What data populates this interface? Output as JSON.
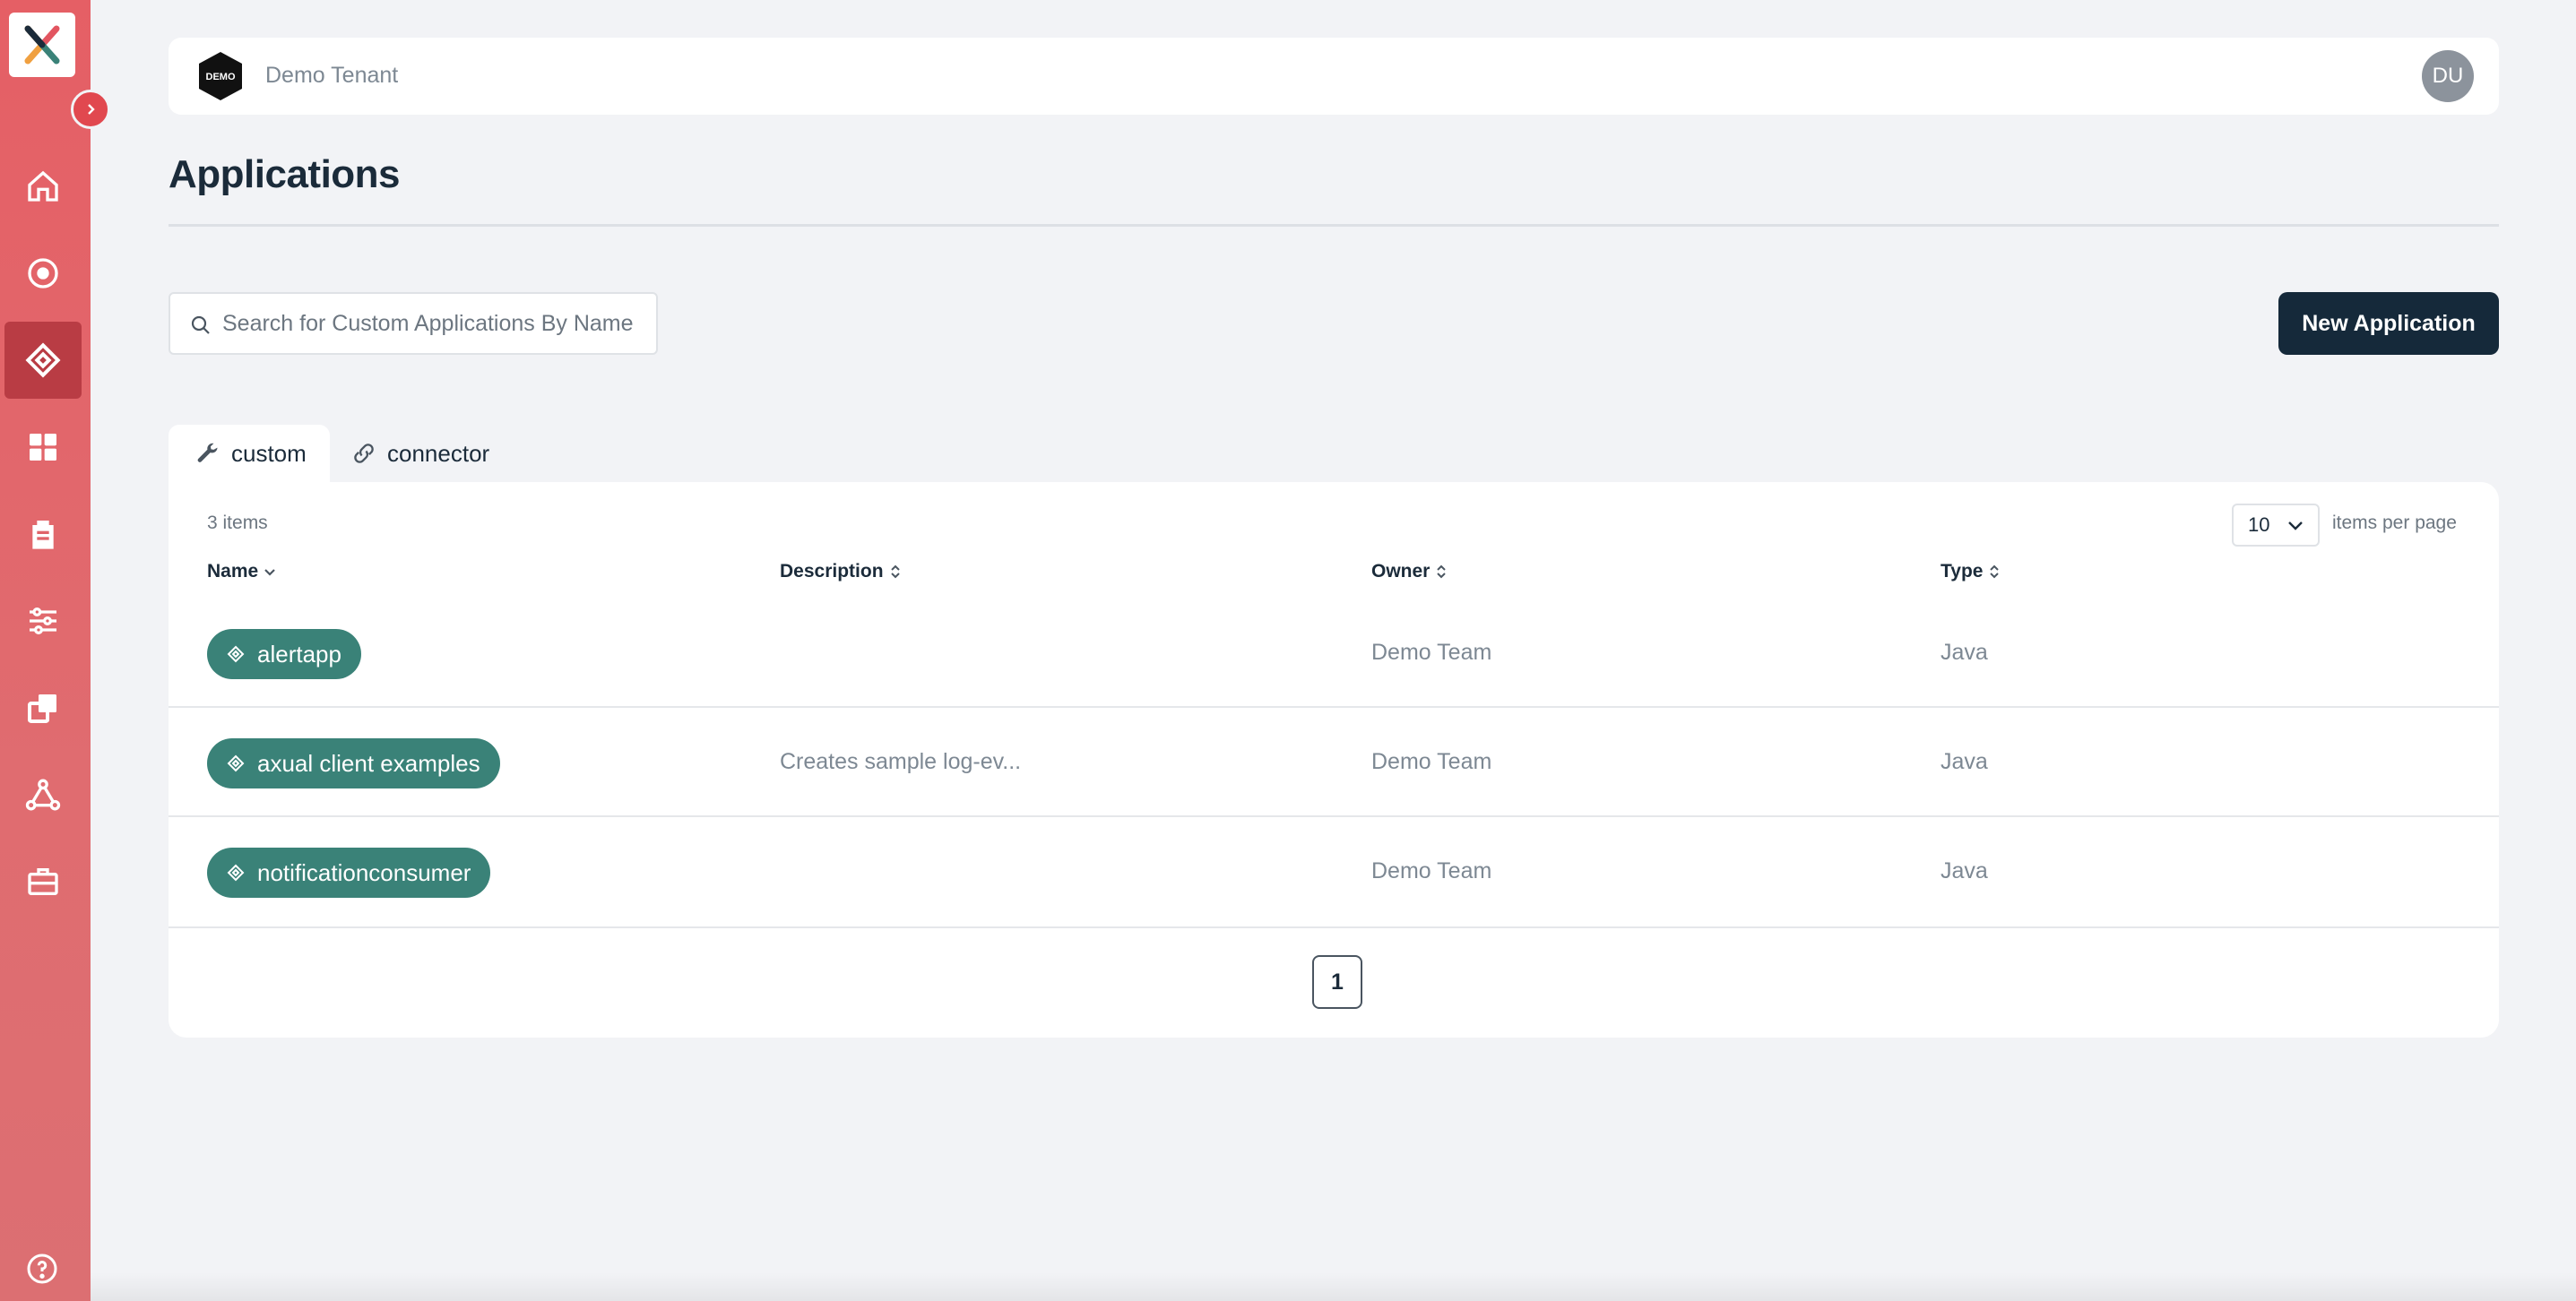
{
  "tenant": {
    "name": "Demo Tenant",
    "logo_text": "DEMO",
    "avatar_initials": "DU"
  },
  "page": {
    "title": "Applications"
  },
  "search": {
    "placeholder": "Search for Custom Applications By Name",
    "value": ""
  },
  "actions": {
    "new_application_label": "New Application"
  },
  "tabs": [
    {
      "label": "custom",
      "icon": "wrench-icon",
      "active": true
    },
    {
      "label": "connector",
      "icon": "link-icon",
      "active": false
    }
  ],
  "table": {
    "items_count": "3 items",
    "per_page": "10",
    "per_page_label": "items per page",
    "columns": {
      "name": "Name",
      "description": "Description",
      "owner": "Owner",
      "type": "Type"
    },
    "rows": [
      {
        "name": "alertapp",
        "description": "",
        "owner": "Demo Team",
        "type": "Java"
      },
      {
        "name": "axual client examples",
        "description": "Creates sample log-ev...",
        "owner": "Demo Team",
        "type": "Java"
      },
      {
        "name": "notificationconsumer",
        "description": "",
        "owner": "Demo Team",
        "type": "Java"
      }
    ],
    "current_page": "1"
  },
  "sidebar": {
    "items": [
      {
        "name": "home-icon",
        "active": false
      },
      {
        "name": "target-icon",
        "active": false
      },
      {
        "name": "applications-icon",
        "active": true
      },
      {
        "name": "dashboard-icon",
        "active": false
      },
      {
        "name": "clipboard-icon",
        "active": false
      },
      {
        "name": "sliders-icon",
        "active": false
      },
      {
        "name": "copy-icon",
        "active": false
      },
      {
        "name": "network-icon",
        "active": false
      },
      {
        "name": "briefcase-icon",
        "active": false
      }
    ]
  },
  "colors": {
    "sidebar": "#e55f65",
    "primary_button": "#15293a",
    "pill": "#3a8278"
  }
}
